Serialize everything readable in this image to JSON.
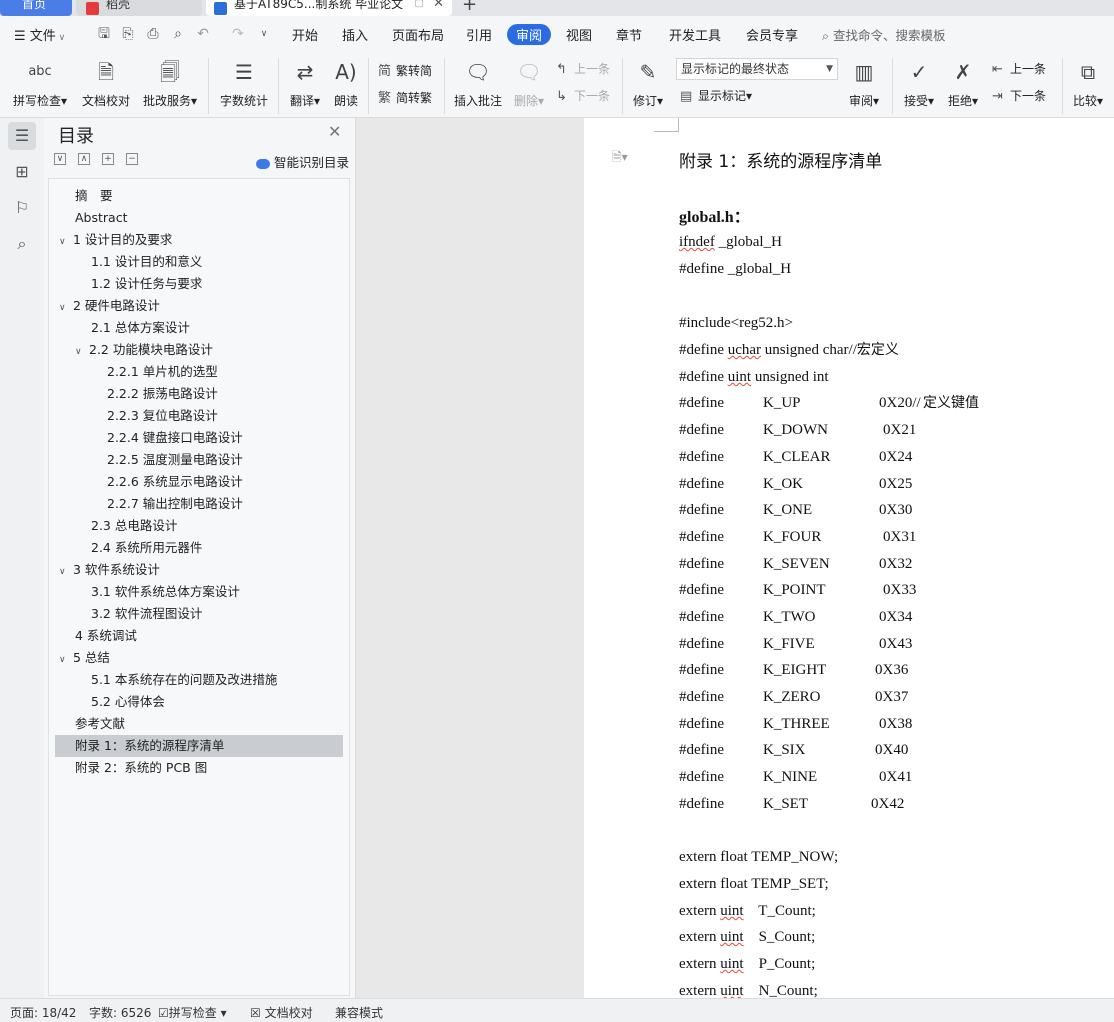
{
  "tabs": [
    {
      "label": "首页"
    },
    {
      "label": "稻壳"
    },
    {
      "label": "基于AT89C5...制系统 毕业论文"
    }
  ],
  "menu": {
    "file": "文件",
    "items": [
      "开始",
      "插入",
      "页面布局",
      "引用",
      "审阅",
      "视图",
      "章节",
      "开发工具",
      "会员专享"
    ],
    "active": "审阅",
    "search_placeholder": "查找命令、搜索模板"
  },
  "ribbon": {
    "spellcheck": "拼写检查",
    "doccheck": "文档校对",
    "review_service": "批改服务",
    "wordcount": "字数统计",
    "translate": "翻译",
    "read_aloud": "朗读",
    "trad_to_simp": "繁转简",
    "simp_to_trad": "简转繁",
    "insert_comment": "插入批注",
    "delete": "删除",
    "prev_comment": "上一条",
    "next_comment": "下一条",
    "track_changes": "修订",
    "markup_state": "显示标记的最终状态",
    "show_markup": "显示标记",
    "review_pane": "审阅",
    "accept": "接受",
    "reject": "拒绝",
    "prev_change": "上一条",
    "next_change": "下一条",
    "compare": "比较"
  },
  "toc": {
    "title": "目录",
    "smart": "智能识别目录",
    "items": [
      {
        "text": "摘　要"
      },
      {
        "text": "Abstract"
      },
      {
        "text": "1  设计目的及要求"
      },
      {
        "text": "1.1  设计目的和意义"
      },
      {
        "text": "1.2  设计任务与要求"
      },
      {
        "text": "2  硬件电路设计"
      },
      {
        "text": "2.1  总体方案设计"
      },
      {
        "text": "2.2  功能模块电路设计"
      },
      {
        "text": "2.2.1  单片机的选型"
      },
      {
        "text": "2.2.2  振荡电路设计"
      },
      {
        "text": "2.2.3  复位电路设计"
      },
      {
        "text": "2.2.4  键盘接口电路设计"
      },
      {
        "text": "2.2.5  温度测量电路设计"
      },
      {
        "text": "2.2.6  系统显示电路设计"
      },
      {
        "text": "2.2.7  输出控制电路设计"
      },
      {
        "text": "2.3  总电路设计"
      },
      {
        "text": "2.4  系统所用元器件"
      },
      {
        "text": "3  软件系统设计"
      },
      {
        "text": "3.1  软件系统总体方案设计"
      },
      {
        "text": "3.2  软件流程图设计"
      },
      {
        "text": "4  系统调试"
      },
      {
        "text": "5  总结"
      },
      {
        "text": "5.1  本系统存在的问题及改进措施"
      },
      {
        "text": "5.2  心得体会"
      },
      {
        "text": "参考文献"
      },
      {
        "text": "附录 1：系统的源程序清单"
      },
      {
        "text": "附录 2：系统的 PCB 图"
      }
    ]
  },
  "document": {
    "heading": "附录 1：系统的源程序清单",
    "file_label": "global.h：",
    "lines": [
      {
        "a": "ifndef _global_H"
      },
      {
        "a": "#define _global_H"
      },
      {
        "a": "#include<reg52.h>"
      },
      {
        "a": "#define uchar unsigned char//",
        "zh": "宏定义"
      },
      {
        "a": "#define uint unsigned int"
      },
      {
        "kw": "#define",
        "name": "K_UP",
        "val": "0X20//",
        "zh": "定义键值"
      },
      {
        "kw": "#define",
        "name": "K_DOWN",
        "val": "0X21"
      },
      {
        "kw": "#define",
        "name": "K_CLEAR",
        "val": "0X24"
      },
      {
        "kw": "#define",
        "name": "K_OK",
        "val": "0X25"
      },
      {
        "kw": "#define",
        "name": "K_ONE",
        "val": "0X30"
      },
      {
        "kw": "#define",
        "name": "K_FOUR",
        "val": "0X31"
      },
      {
        "kw": "#define",
        "name": "K_SEVEN",
        "val": "0X32"
      },
      {
        "kw": "#define",
        "name": "K_POINT",
        "val": "0X33"
      },
      {
        "kw": "#define",
        "name": "K_TWO",
        "val": "0X34"
      },
      {
        "kw": "#define",
        "name": "K_FIVE",
        "val": "0X43"
      },
      {
        "kw": "#define",
        "name": "K_EIGHT",
        "val": "0X36"
      },
      {
        "kw": "#define",
        "name": "K_ZERO",
        "val": "0X37"
      },
      {
        "kw": "#define",
        "name": "K_THREE",
        "val": "0X38"
      },
      {
        "kw": "#define",
        "name": "K_SIX",
        "val": "0X40"
      },
      {
        "kw": "#define",
        "name": "K_NINE",
        "val": "0X41"
      },
      {
        "kw": "#define",
        "name": "K_SET",
        "val": "0X42"
      },
      {
        "a": "extern float TEMP_NOW;"
      },
      {
        "a": "extern float TEMP_SET;"
      },
      {
        "a": "extern uint    T_Count;"
      },
      {
        "a": "extern uint    S_Count;"
      },
      {
        "a": "extern uint    P_Count;"
      },
      {
        "a": "extern uint    N_Count;"
      }
    ]
  },
  "status": {
    "page": "页面: 18/42",
    "words": "字数: 6526",
    "spell": "拼写检查",
    "proof": "文档校对",
    "compat": "兼容模式"
  },
  "colors": {
    "accent": "#2b6de0",
    "selection": "#c9ccd0"
  }
}
